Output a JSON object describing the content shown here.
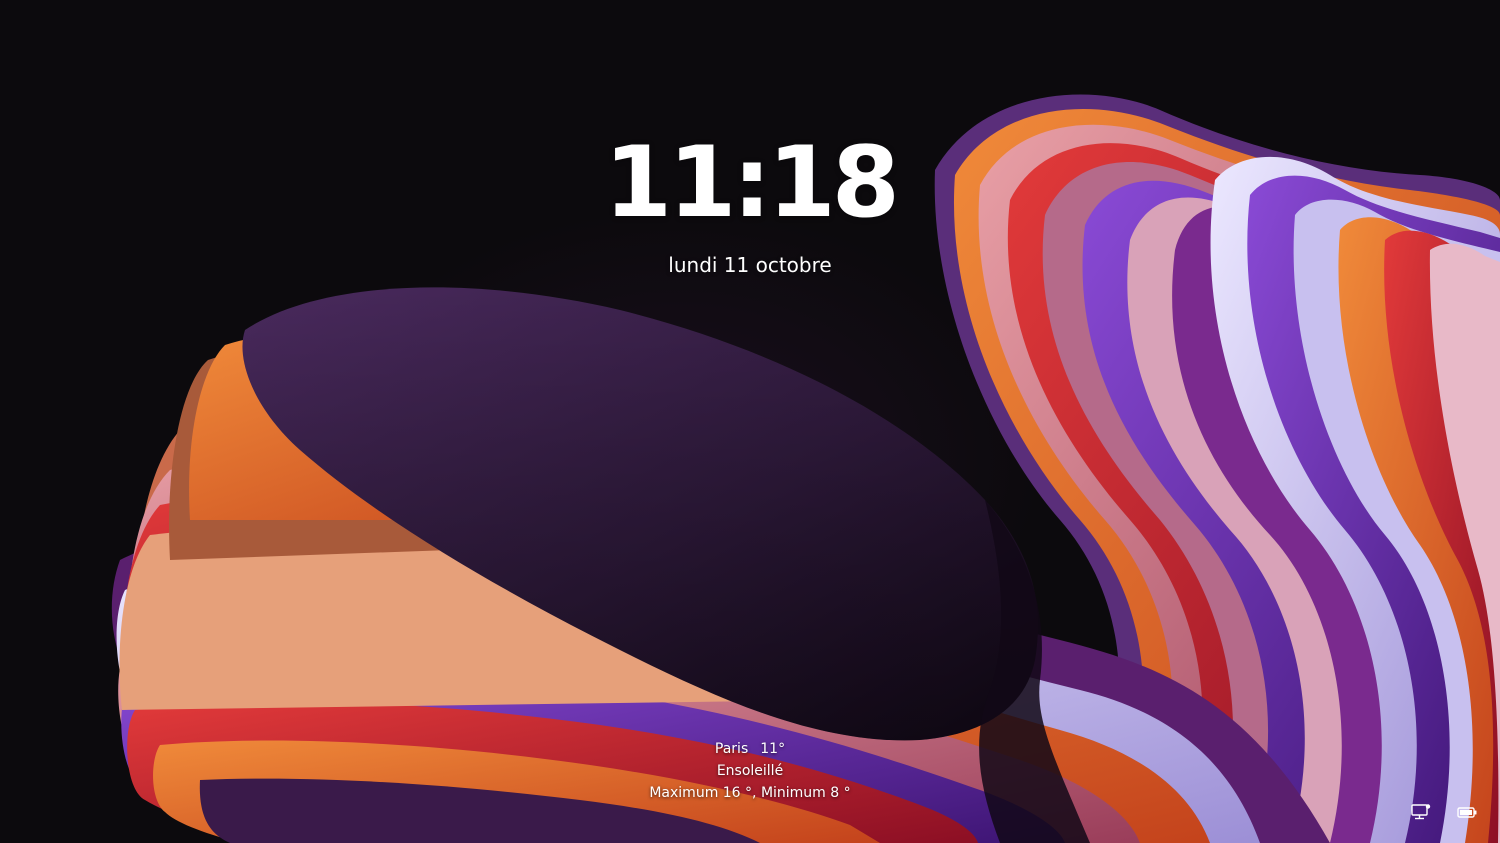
{
  "lockscreen": {
    "time": "11:18",
    "date": "lundi 11 octobre"
  },
  "weather": {
    "city": "Paris",
    "temperature": "11°",
    "condition": "Ensoleillé",
    "range": "Maximum 16 °, Minimum 8 °"
  },
  "tray": {
    "icons": [
      "network-icon",
      "battery-icon"
    ]
  },
  "colors": {
    "background": "#0c0a0d",
    "text": "#ffffff",
    "bloom_purple": "#3b2248",
    "accent_orange": "#e0662a",
    "accent_red": "#c0182c",
    "accent_violet": "#6a2bb8",
    "accent_lavender": "#c9c2ec"
  }
}
